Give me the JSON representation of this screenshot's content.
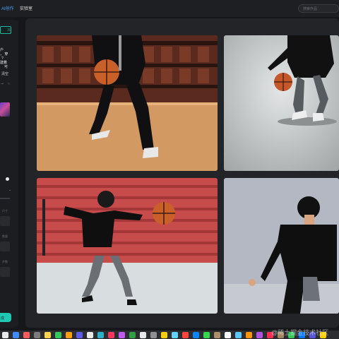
{
  "topbar": {
    "nav": [
      "AI创作",
      "实验室"
    ],
    "search_placeholder": "搜索作品"
  },
  "panel": {
    "tab_label": "义",
    "prompt_lines": [
      "户",
      "， 穿",
      "住个",
      "?",
      "建着",
      "可"
    ],
    "clear_label": "清空",
    "field_labels": [
      "尺寸",
      "数量",
      "步数"
    ],
    "generate_label": "成"
  },
  "gallery": {
    "images": [
      {
        "name": "basketball-player-gym"
      },
      {
        "name": "basketball-player-studio"
      },
      {
        "name": "basketball-player-stairs"
      },
      {
        "name": "basketball-player-grey"
      }
    ]
  },
  "dock": {
    "colors": [
      "#e9e9e9",
      "#3d8bff",
      "#ff5b5b",
      "#7c7c7c",
      "#ffd34d",
      "#34c759",
      "#ff9f0a",
      "#5e5ce6",
      "#e9e9e9",
      "#30b0c7",
      "#ff375f",
      "#bf5af2",
      "#2ea043",
      "#e9e9e9",
      "#8e8e93",
      "#ffcc00",
      "#64d2ff",
      "#ff453a",
      "#0a84ff",
      "#32d74b",
      "#ac8e68",
      "#ffffff",
      "#5ac8fa",
      "#ff9500",
      "#af52de",
      "#ff2d55",
      "#a2845e",
      "#34c759",
      "#007aff",
      "#5856d6",
      "#ffcc00"
    ]
  },
  "watermark": "@稀土掘金技术社区"
}
